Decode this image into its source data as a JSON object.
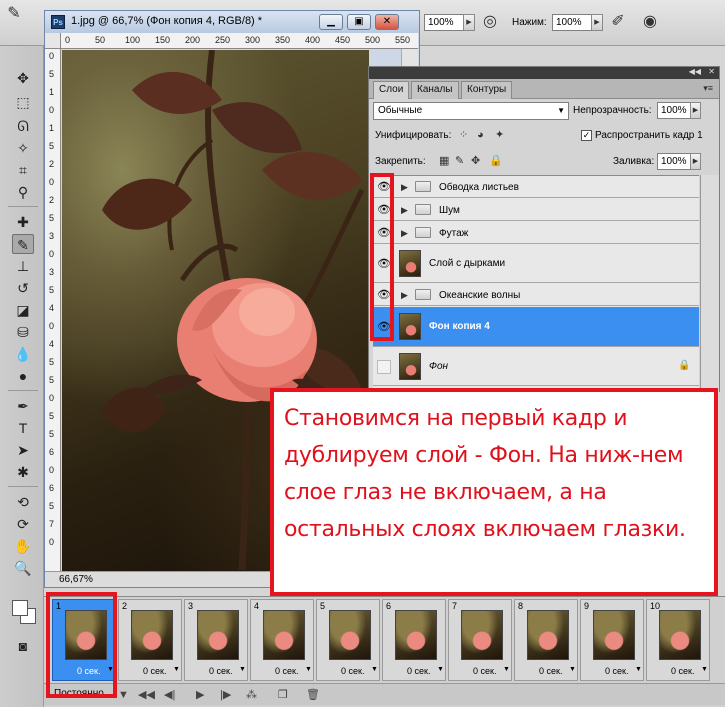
{
  "optionbar": {
    "opacity_value": "100%",
    "press_label": "Нажим:",
    "press_value": "100%"
  },
  "document": {
    "title": "1.jpg @ 66,7% (Фон копия 4, RGB/8) *",
    "zoom": "66,67%",
    "ruler_h": [
      "0",
      "50",
      "100",
      "150",
      "200",
      "250",
      "300",
      "350",
      "400",
      "450",
      "500",
      "550"
    ],
    "ruler_v": [
      "0",
      "5",
      "1",
      "0",
      "1",
      "5",
      "2",
      "0",
      "2",
      "5",
      "3",
      "0",
      "3",
      "5",
      "4",
      "0",
      "4",
      "5",
      "5",
      "0",
      "5",
      "5",
      "6",
      "0",
      "6",
      "5",
      "7",
      "0"
    ]
  },
  "layers_panel": {
    "tabs": [
      "Слои",
      "Каналы",
      "Контуры"
    ],
    "blend_mode": "Обычные",
    "opacity_label": "Непрозрачность:",
    "opacity_value": "100%",
    "unify_label": "Унифицировать:",
    "propagate_label": "Распространить кадр 1",
    "lock_label": "Закрепить:",
    "fill_label": "Заливка:",
    "fill_value": "100%",
    "layers": [
      {
        "name": "Обводка листьев",
        "type": "group",
        "visible": true
      },
      {
        "name": "Шум",
        "type": "group",
        "visible": true
      },
      {
        "name": "Футаж",
        "type": "group",
        "visible": true
      },
      {
        "name": "Слой с дырками",
        "type": "layer",
        "visible": true
      },
      {
        "name": "Океанские волны",
        "type": "group",
        "visible": true
      },
      {
        "name": "Фон копия 4",
        "type": "layer",
        "visible": true,
        "selected": true
      },
      {
        "name": "Фон",
        "type": "layer",
        "visible": false,
        "locked": true
      }
    ]
  },
  "note": {
    "text": "Становимся на первый кадр и дублируем слой - Фон. На ниж-нем слое глаз не включаем, а на остальных слоях включаем глазки."
  },
  "animation": {
    "loop": "Постоянно",
    "frames": [
      {
        "num": "1",
        "time": "0 сек."
      },
      {
        "num": "2",
        "time": "0 сек."
      },
      {
        "num": "3",
        "time": "0 сек."
      },
      {
        "num": "4",
        "time": "0 сек."
      },
      {
        "num": "5",
        "time": "0 сек."
      },
      {
        "num": "6",
        "time": "0 сек."
      },
      {
        "num": "7",
        "time": "0 сек."
      },
      {
        "num": "8",
        "time": "0 сек."
      },
      {
        "num": "9",
        "time": "0 сек."
      },
      {
        "num": "10",
        "time": "0 сек."
      }
    ]
  },
  "colors": {
    "accent_red": "#e5141f",
    "selection_blue": "#3a8ff0"
  }
}
